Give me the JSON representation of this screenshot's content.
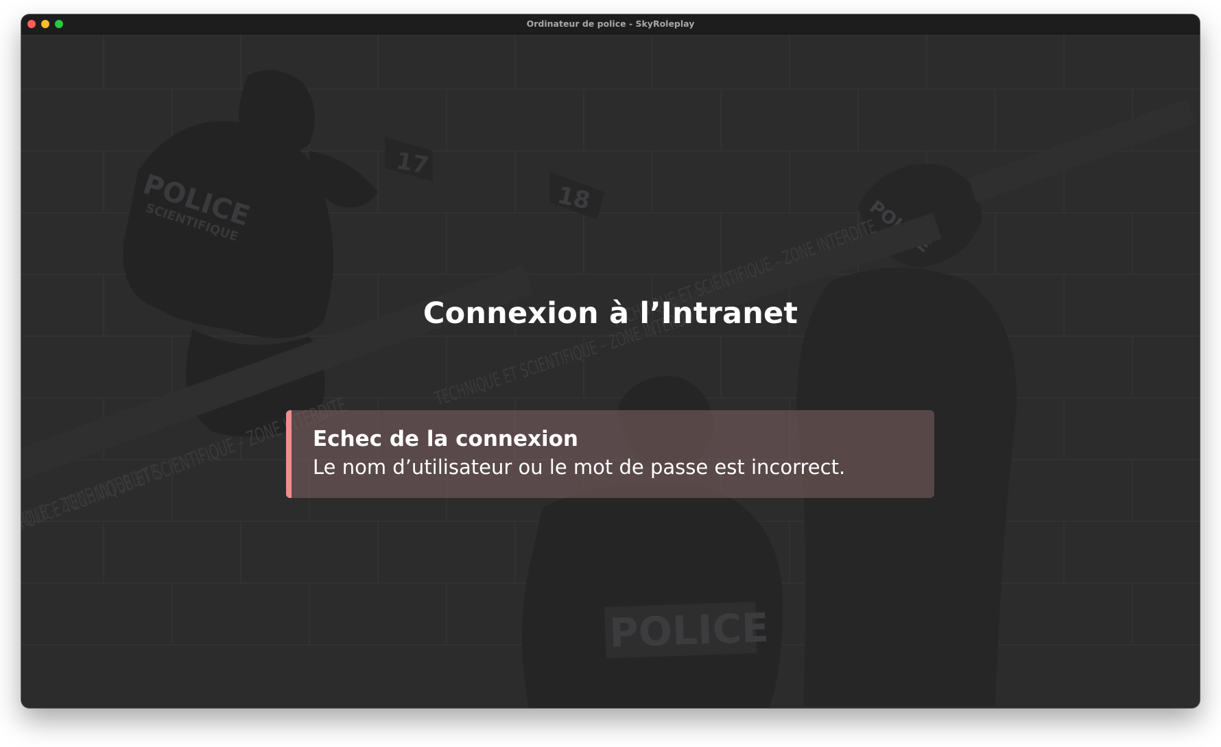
{
  "window": {
    "title": "Ordinateur de police - SkyRoleplay",
    "controls": [
      "close-icon",
      "minimize-icon",
      "maximize-icon"
    ]
  },
  "background": {
    "vest_text": "POLICE",
    "jacket_text_1": "POLICE",
    "jacket_text_2": "SCIENTIFIQUE",
    "cap_text": "POLICE",
    "marker_1": "17",
    "marker_2": "18",
    "tape_1": "POLICE TECHNIQUE ET SCIENTIFIQUE – ZONE INTERDITE",
    "tape_2": "TECHNIQUE ET SCIENTIFIQUE – ZONE INTERDITE",
    "tape_3": "TECHNIQUE ET SCIENTIFIQUE – ZONE INTERDITE",
    "tape_4": "IQUE – ZONE INTERDITE"
  },
  "login": {
    "title": "Connexion à l’Intranet"
  },
  "alert": {
    "heading": "Echec de la connexion",
    "message": "Le nom d’utilisateur ou le mot de passe est incorrect.",
    "accent_color": "#f08d8d"
  }
}
